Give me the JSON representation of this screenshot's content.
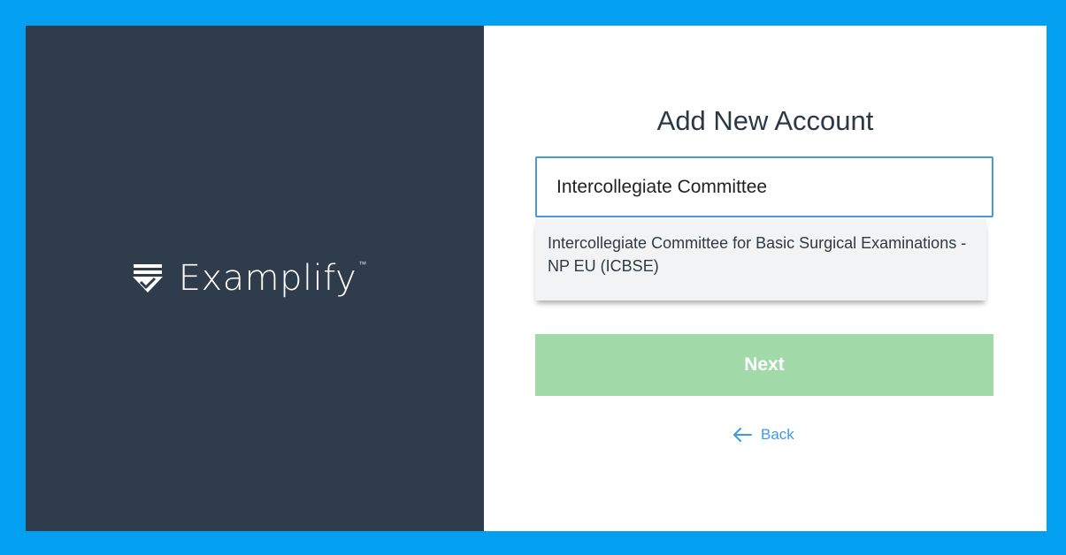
{
  "brand": {
    "name": "Examplify",
    "trademark": "™",
    "logo_icon": "stacked-check-icon",
    "panel_color": "#2e3c4c"
  },
  "form": {
    "title": "Add New Account",
    "search_value": "Intercollegiate Committee",
    "suggestions": [
      {
        "label": "Intercollegiate Committee for Basic Surgical Examinations - NP EU (ICBSE)"
      }
    ],
    "next_label": "Next",
    "back_label": "Back",
    "back_icon": "arrow-left-icon"
  },
  "colors": {
    "background": "#03a0f2",
    "input_border": "#4a98dc",
    "next_button": "#a2d9a8",
    "link": "#3e9ae3"
  }
}
